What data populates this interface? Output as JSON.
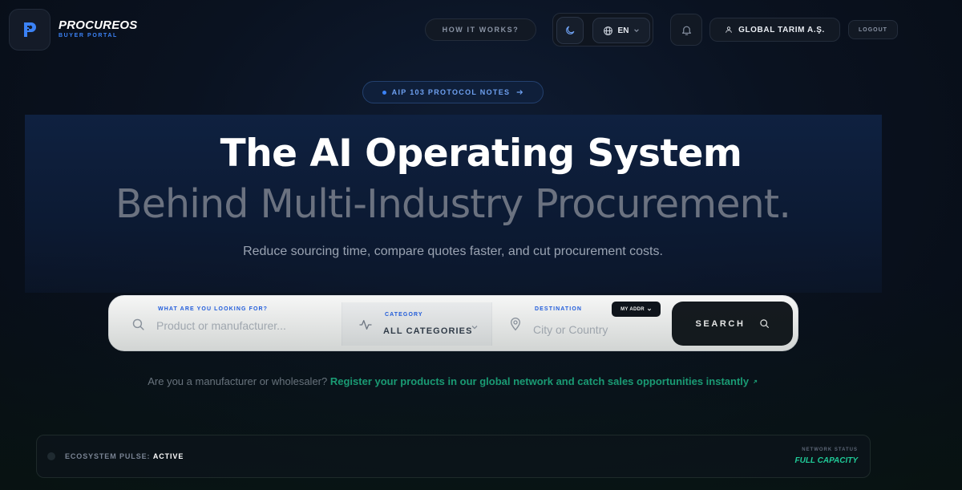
{
  "brand": {
    "name": "PROCUREOS",
    "subtitle": "BUYER PORTAL"
  },
  "header": {
    "how_it_works": "HOW IT WORKS?",
    "language": "EN",
    "user_name": "GLOBAL TARIM A.Ş.",
    "logout": "LOGOUT"
  },
  "announcement": {
    "label": "AIP 103 PROTOCOL NOTES"
  },
  "hero": {
    "title": "The AI Operating System",
    "subtitle": "Behind Multi-Industry Procurement.",
    "description": "Reduce sourcing time, compare quotes faster, and cut procurement costs."
  },
  "search": {
    "what_label": "WHAT ARE YOU LOOKING FOR?",
    "what_placeholder": "Product or manufacturer...",
    "category_label": "CATEGORY",
    "category_value": "ALL CATEGORIES",
    "destination_label": "DESTINATION",
    "destination_placeholder": "City or Country",
    "my_address": "MY ADDR",
    "button": "SEARCH"
  },
  "register": {
    "prompt": "Are you a manufacturer or wholesaler?",
    "link": "Register your products in our global network and catch sales opportunities instantly"
  },
  "status": {
    "pulse_label": "ECOSYSTEM PULSE:",
    "pulse_value": "ACTIVE",
    "network_label": "NETWORK STATUS",
    "network_value": "FULL CAPACITY"
  },
  "colors": {
    "accent": "#3b82f6",
    "success": "#20c997",
    "background": "#0a1220"
  }
}
